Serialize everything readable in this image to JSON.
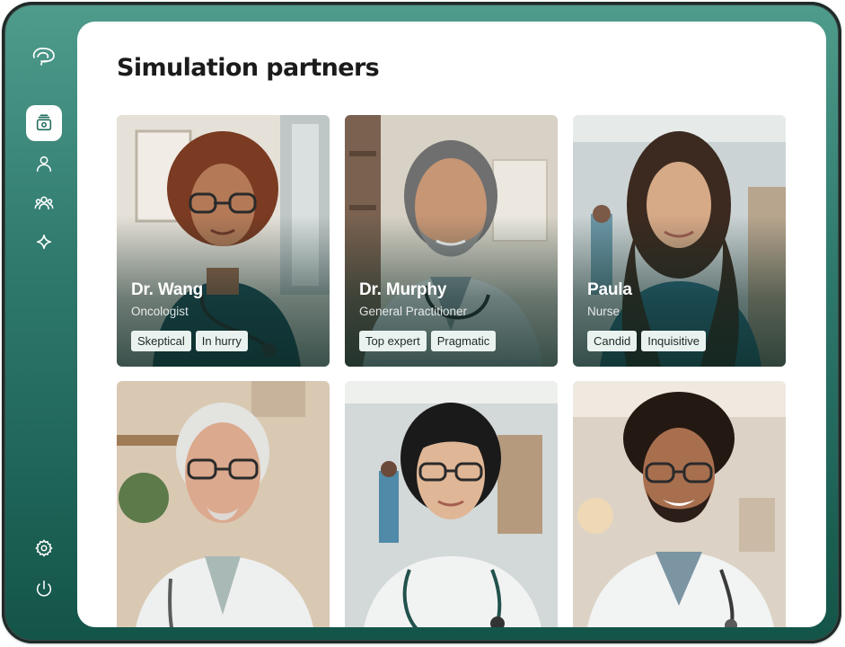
{
  "page": {
    "title": "Simulation partners"
  },
  "sidebar": {
    "logo": "brain-logo-icon",
    "items": [
      {
        "name": "simulations",
        "icon": "cube-box-icon",
        "active": true
      },
      {
        "name": "profile",
        "icon": "user-icon",
        "active": false
      },
      {
        "name": "partners",
        "icon": "users-group-icon",
        "active": false
      },
      {
        "name": "ai",
        "icon": "sparkle-icon",
        "active": false
      }
    ],
    "bottom_items": [
      {
        "name": "settings",
        "icon": "gear-icon"
      },
      {
        "name": "logout",
        "icon": "power-icon"
      }
    ]
  },
  "partners": [
    {
      "name": "Dr. Wang",
      "role": "Oncologist",
      "tags": [
        "Skeptical",
        "In hurry"
      ]
    },
    {
      "name": "Dr. Murphy",
      "role": "General Practitioner",
      "tags": [
        "Top expert",
        "Pragmatic"
      ]
    },
    {
      "name": "Paula",
      "role": "Nurse",
      "tags": [
        "Candid",
        "Inquisitive"
      ]
    },
    {
      "name": "",
      "role": "",
      "tags": []
    },
    {
      "name": "",
      "role": "",
      "tags": []
    },
    {
      "name": "",
      "role": "",
      "tags": []
    }
  ],
  "colors": {
    "accent": "#1f6b5d",
    "sidebar_top": "#4f9c8c",
    "sidebar_bottom": "#135448",
    "tag_bg": "#eaf2ef"
  }
}
